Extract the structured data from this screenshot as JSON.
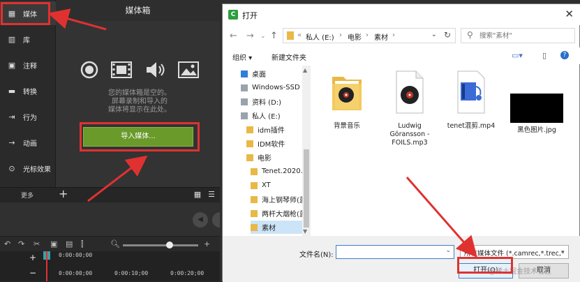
{
  "colors": {
    "accent_red": "#e03131",
    "import_green": "#6a9a2a",
    "dialog_blue": "#3c7fc4"
  },
  "rail": {
    "items": [
      {
        "label": "媒体",
        "icon": "film-strip-icon",
        "glyph": "▦"
      },
      {
        "label": "库",
        "icon": "library-books-icon",
        "glyph": "▥"
      },
      {
        "label": "注释",
        "icon": "annotation-icon",
        "glyph": "▣"
      },
      {
        "label": "转换",
        "icon": "transition-icon",
        "glyph": "▬"
      },
      {
        "label": "行为",
        "icon": "behavior-icon",
        "glyph": "⇥"
      },
      {
        "label": "动画",
        "icon": "animation-icon",
        "glyph": "→"
      },
      {
        "label": "光标效果",
        "icon": "cursor-effect-icon",
        "glyph": "⊙"
      }
    ],
    "more_label": "更多"
  },
  "bin": {
    "title": "媒体箱",
    "empty_message": [
      "您的媒体箱是空的。",
      "屏幕录制和导入的",
      "媒体将显示在此处。"
    ],
    "import_button": "导入媒体..."
  },
  "timeline": {
    "times": [
      "0:00:00;00",
      "0:00:00;00",
      "0:00:10;00",
      "0:00:20;00"
    ]
  },
  "dialog": {
    "title": "打开",
    "breadcrumb": [
      "«",
      "私人 (E:)",
      "›",
      "电影",
      "›",
      "素材",
      "›"
    ],
    "search_placeholder": "搜索\"素材\"",
    "organize": "组织 ▾",
    "new_folder": "新建文件夹",
    "tree": [
      {
        "label": "桌面",
        "indent": 1,
        "type": "desktop"
      },
      {
        "label": "Windows-SSD (",
        "indent": 1,
        "type": "drive"
      },
      {
        "label": "资料 (D:)",
        "indent": 1,
        "type": "drive"
      },
      {
        "label": "私人 (E:)",
        "indent": 1,
        "type": "drive"
      },
      {
        "label": "idm插件",
        "indent": 2,
        "type": "folder"
      },
      {
        "label": "IDM软件",
        "indent": 2,
        "type": "folder"
      },
      {
        "label": "电影",
        "indent": 2,
        "type": "folder"
      },
      {
        "label": "Tenet.2020.I",
        "indent": 3,
        "type": "folder"
      },
      {
        "label": "XT",
        "indent": 3,
        "type": "folder"
      },
      {
        "label": "海上钢琴师(蓝",
        "indent": 3,
        "type": "folder"
      },
      {
        "label": "两杆大烟枪(蓝",
        "indent": 3,
        "type": "folder"
      },
      {
        "label": "素材",
        "indent": 3,
        "type": "folder",
        "selected": true
      }
    ],
    "files": [
      {
        "name": "背景音乐",
        "type": "folder-music"
      },
      {
        "name": "Ludwig\nGöransson -\nFOILS.mp3",
        "type": "audio"
      },
      {
        "name": "tenet混剪.mp4",
        "type": "video"
      },
      {
        "name": "黑色图片.jpg",
        "type": "image-black"
      }
    ],
    "filename_label": "文件名(N):",
    "filename_value": "",
    "filetype": "所有媒体文件 (*.camrec,*.trec,*",
    "open_button": "打开(O)",
    "cancel_button": "取消"
  },
  "watermark": "@稀土掘金技术社区"
}
